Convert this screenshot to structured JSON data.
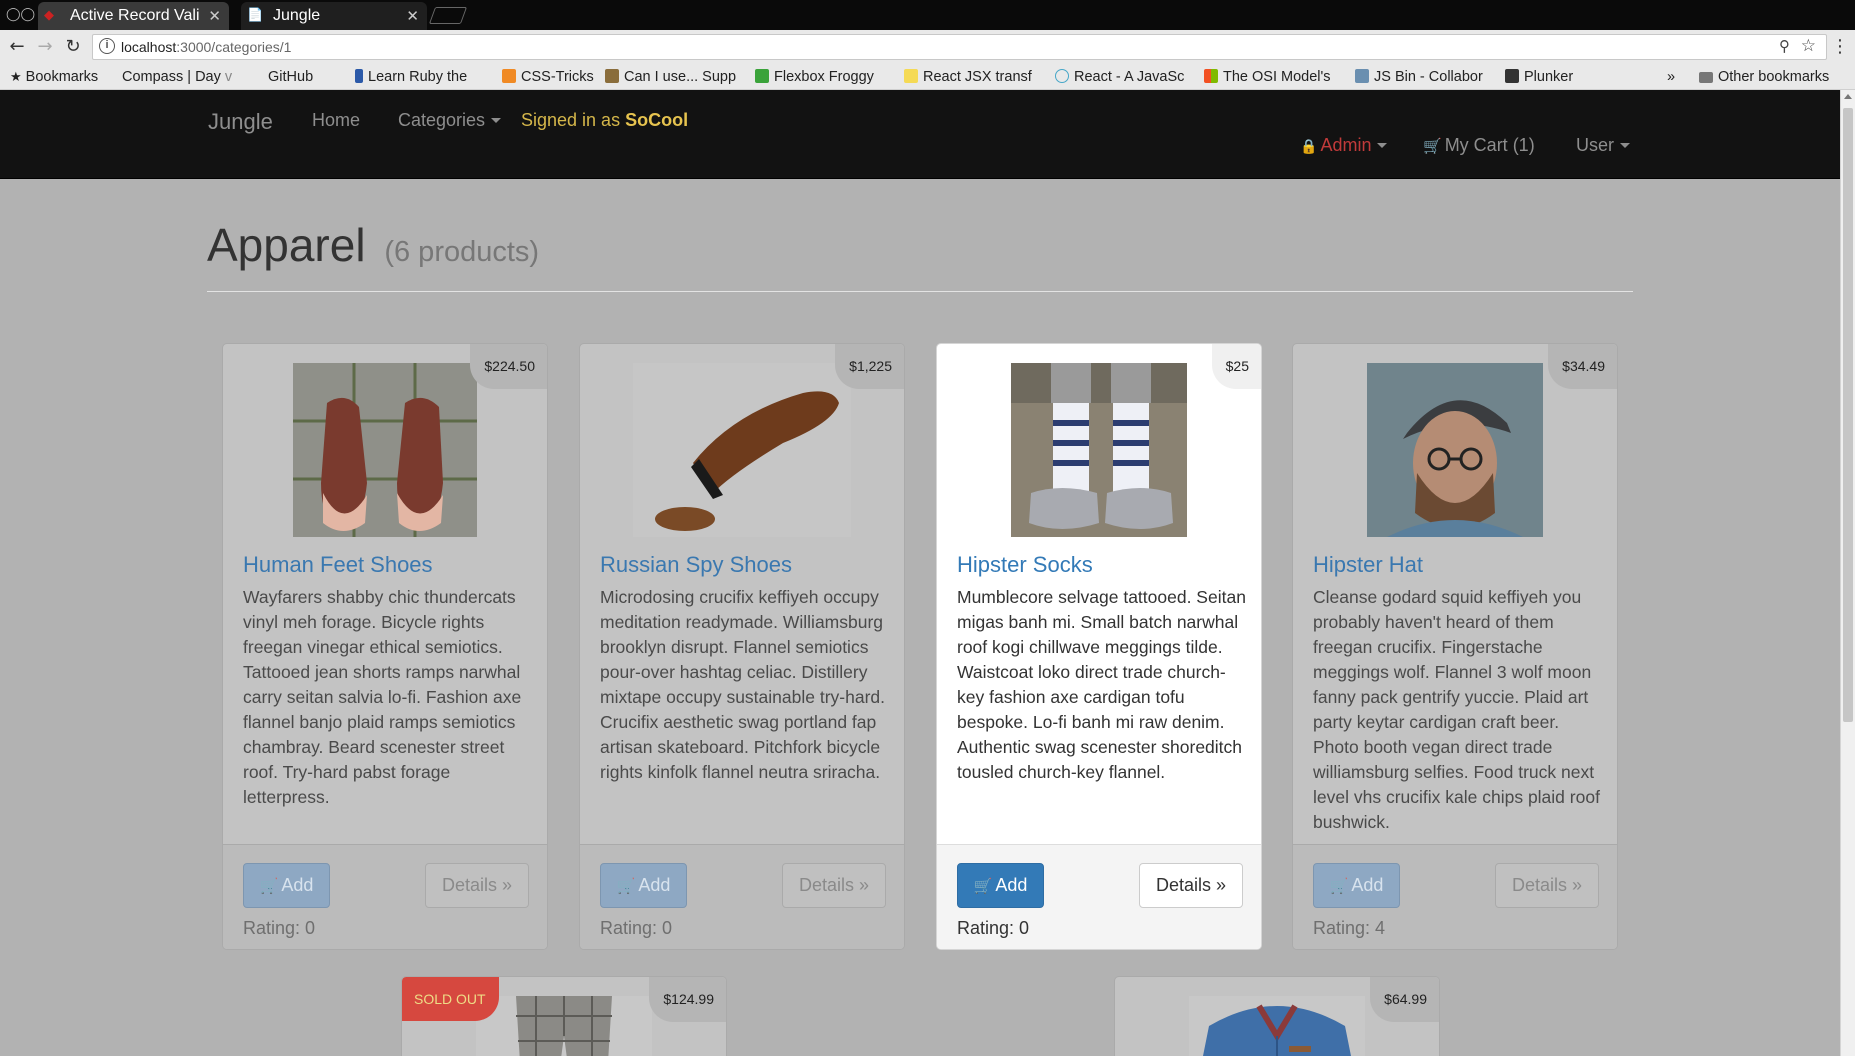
{
  "browser": {
    "tabs": [
      {
        "title": "Active Record Vali"
      },
      {
        "title": "Jungle"
      }
    ],
    "url_host": "localhost",
    "url_path": ":3000/categories/1",
    "bookmarks": [
      "Bookmarks",
      "Compass | Day",
      "GitHub",
      "Learn Ruby the",
      "CSS-Tricks",
      "Can I use... Supp",
      "Flexbox Froggy",
      "React JSX transf",
      "React - A JavaSc",
      "The OSI Model's",
      "JS Bin - Collabor",
      "Plunker"
    ],
    "bookmarks_more": "»",
    "other_bookmarks": "Other bookmarks"
  },
  "navbar": {
    "brand": "Jungle",
    "home": "Home",
    "categories": "Categories",
    "signed_in_prefix": "Signed in as",
    "username": "SoCool",
    "admin": "Admin",
    "cart": "My Cart (1)",
    "user": "User"
  },
  "page": {
    "title": "Apparel",
    "count": "(6 products)"
  },
  "colors": {
    "navbar_bg": "#121212",
    "link_blue": "#337ab7",
    "sold_out_red": "#d6483f",
    "signed_in_gold": "#e6c34f"
  },
  "products": [
    {
      "name": "Human Feet Shoes",
      "price": "$224.50",
      "description": "Wayfarers shabby chic thundercats vinyl meh forage. Bicycle rights freegan vinegar ethical semiotics. Tattooed jean shorts ramps narwhal carry seitan salvia lo-fi. Fashion axe flannel banjo plaid ramps semiotics chambray. Beard scenester street roof. Try-hard pabst forage letterpress.",
      "add": "Add",
      "details": "Details »",
      "rating": "Rating: 0"
    },
    {
      "name": "Russian Spy Shoes",
      "price": "$1,225",
      "description": "Microdosing crucifix keffiyeh occupy meditation readymade. Williamsburg brooklyn disrupt. Flannel semiotics pour-over hashtag celiac. Distillery mixtape occupy sustainable try-hard. Crucifix aesthetic swag portland fap artisan skateboard. Pitchfork bicycle rights kinfolk flannel neutra sriracha.",
      "add": "Add",
      "details": "Details »",
      "rating": "Rating: 0"
    },
    {
      "name": "Hipster Socks",
      "price": "$25",
      "description": "Mumblecore selvage tattooed. Seitan migas banh mi. Small batch narwhal roof kogi chillwave meggings tilde. Waistcoat loko direct trade church-key fashion axe cardigan tofu bespoke. Lo-fi banh mi raw denim. Authentic swag scenester shoreditch tousled church-key flannel.",
      "add": "Add",
      "details": "Details »",
      "rating": "Rating: 0"
    },
    {
      "name": "Hipster Hat",
      "price": "$34.49",
      "description": "Cleanse godard squid keffiyeh you probably haven't heard of them freegan crucifix. Fingerstache meggings wolf. Flannel 3 wolf moon fanny pack gentrify yuccie. Plaid art party keytar cardigan craft beer. Photo booth vegan direct trade williamsburg selfies. Food truck next level vhs crucifix kale chips plaid roof bushwick.",
      "add": "Add",
      "details": "Details »",
      "rating": "Rating: 4"
    },
    {
      "sold_out": "SOLD OUT",
      "price": "$124.99"
    },
    {
      "price": "$64.99"
    }
  ]
}
